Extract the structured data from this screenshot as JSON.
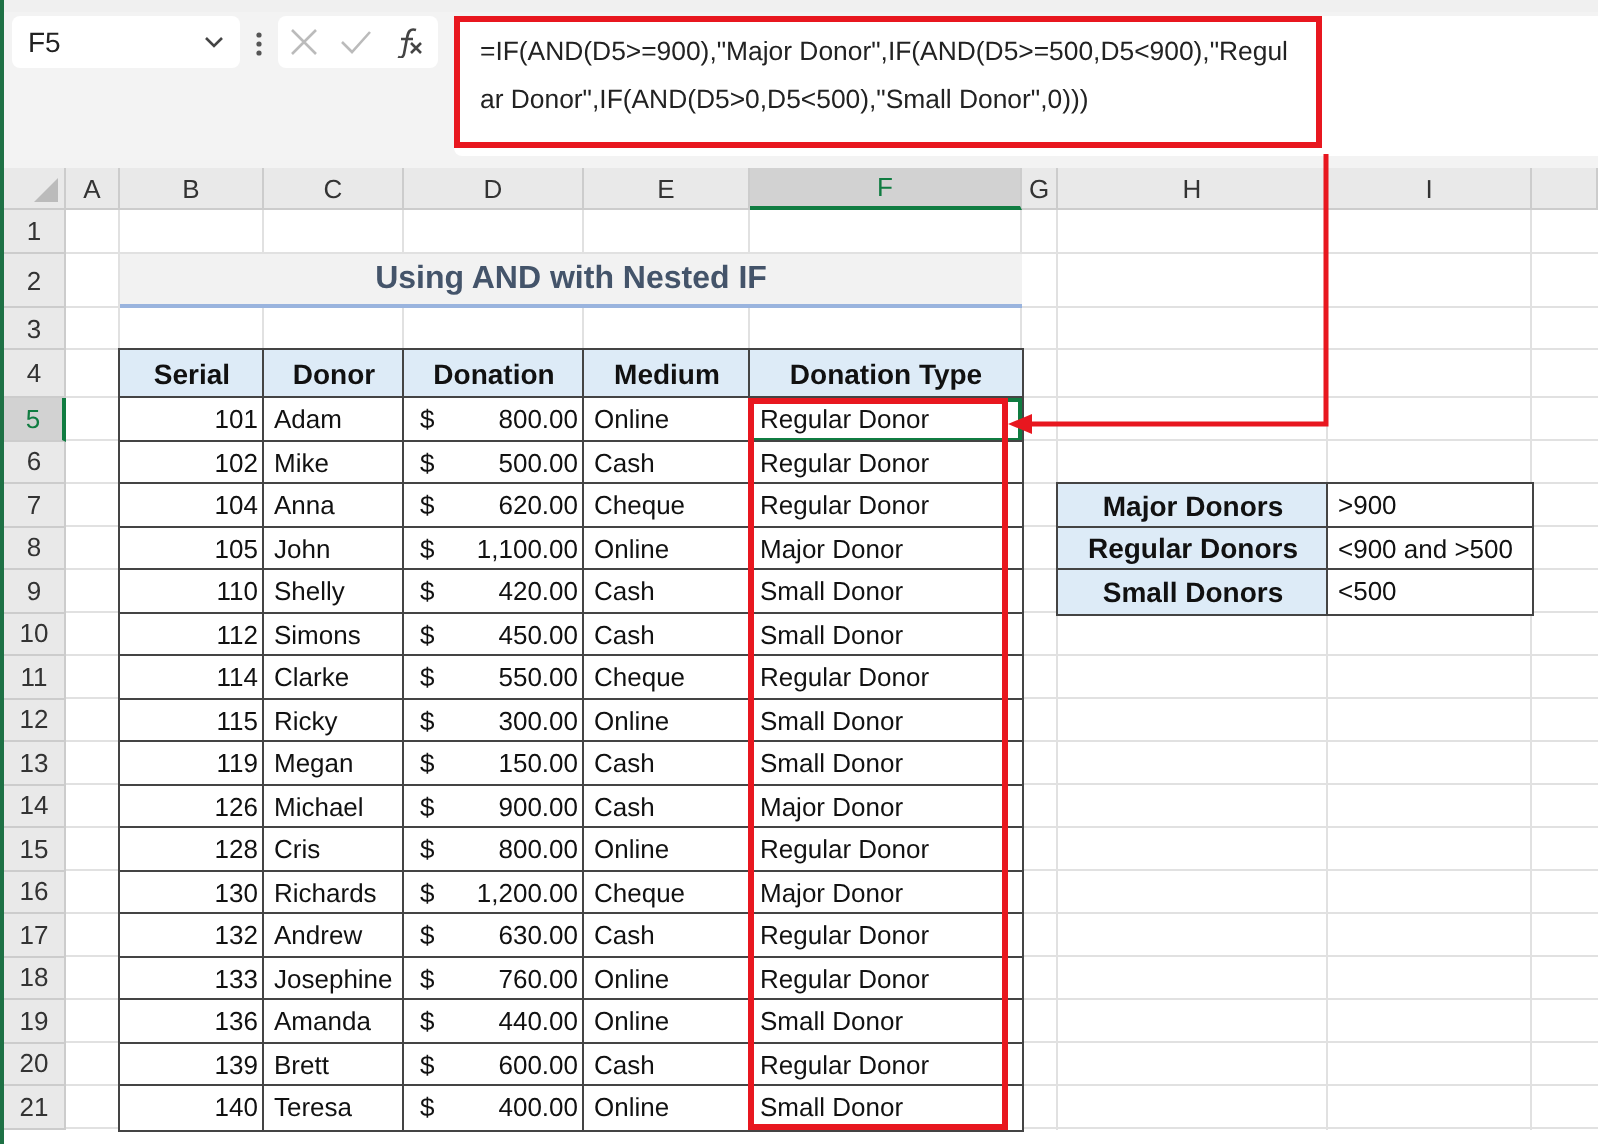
{
  "name_box": "F5",
  "formula": "=IF(AND(D5>=900),\"Major Donor\",IF(AND(D5>=500,D5<900),\"Regular Donor\",IF(AND(D5>0,D5<500),\"Small Donor\",0)))",
  "columns": [
    {
      "label": "A",
      "selected": false
    },
    {
      "label": "B",
      "selected": false
    },
    {
      "label": "C",
      "selected": false
    },
    {
      "label": "D",
      "selected": false
    },
    {
      "label": "E",
      "selected": false
    },
    {
      "label": "F",
      "selected": true
    },
    {
      "label": "G",
      "selected": false
    },
    {
      "label": "H",
      "selected": false
    },
    {
      "label": "I",
      "selected": false
    }
  ],
  "row_numbers": [
    {
      "label": "1",
      "selected": false
    },
    {
      "label": "2",
      "selected": false
    },
    {
      "label": "3",
      "selected": false
    },
    {
      "label": "4",
      "selected": false
    },
    {
      "label": "5",
      "selected": true
    },
    {
      "label": "6",
      "selected": false
    },
    {
      "label": "7",
      "selected": false
    },
    {
      "label": "8",
      "selected": false
    },
    {
      "label": "9",
      "selected": false
    },
    {
      "label": "10",
      "selected": false
    },
    {
      "label": "11",
      "selected": false
    },
    {
      "label": "12",
      "selected": false
    },
    {
      "label": "13",
      "selected": false
    },
    {
      "label": "14",
      "selected": false
    },
    {
      "label": "15",
      "selected": false
    },
    {
      "label": "16",
      "selected": false
    },
    {
      "label": "17",
      "selected": false
    },
    {
      "label": "18",
      "selected": false
    },
    {
      "label": "19",
      "selected": false
    },
    {
      "label": "20",
      "selected": false
    },
    {
      "label": "21",
      "selected": false
    }
  ],
  "title": "Using AND with Nested IF",
  "table": {
    "columns": [
      "Serial",
      "Donor",
      "Donation",
      "Medium",
      "Donation Type"
    ],
    "rows": [
      {
        "serial": "101",
        "donor": "Adam",
        "currency": "$",
        "donation": "800.00",
        "medium": "Online",
        "type": "Regular Donor",
        "selected": true
      },
      {
        "serial": "102",
        "donor": "Mike",
        "currency": "$",
        "donation": "500.00",
        "medium": "Cash",
        "type": "Regular Donor",
        "selected": false
      },
      {
        "serial": "104",
        "donor": "Anna",
        "currency": "$",
        "donation": "620.00",
        "medium": "Cheque",
        "type": "Regular Donor",
        "selected": false
      },
      {
        "serial": "105",
        "donor": "John",
        "currency": "$",
        "donation": "1,100.00",
        "medium": "Online",
        "type": "Major Donor",
        "selected": false
      },
      {
        "serial": "110",
        "donor": "Shelly",
        "currency": "$",
        "donation": "420.00",
        "medium": "Cash",
        "type": "Small Donor",
        "selected": false
      },
      {
        "serial": "112",
        "donor": "Simons",
        "currency": "$",
        "donation": "450.00",
        "medium": "Cash",
        "type": "Small Donor",
        "selected": false
      },
      {
        "serial": "114",
        "donor": "Clarke",
        "currency": "$",
        "donation": "550.00",
        "medium": "Cheque",
        "type": "Regular Donor",
        "selected": false
      },
      {
        "serial": "115",
        "donor": "Ricky",
        "currency": "$",
        "donation": "300.00",
        "medium": "Online",
        "type": "Small Donor",
        "selected": false
      },
      {
        "serial": "119",
        "donor": "Megan",
        "currency": "$",
        "donation": "150.00",
        "medium": "Cash",
        "type": "Small Donor",
        "selected": false
      },
      {
        "serial": "126",
        "donor": "Michael",
        "currency": "$",
        "donation": "900.00",
        "medium": "Cash",
        "type": "Major Donor",
        "selected": false
      },
      {
        "serial": "128",
        "donor": "Cris",
        "currency": "$",
        "donation": "800.00",
        "medium": "Online",
        "type": "Regular Donor",
        "selected": false
      },
      {
        "serial": "130",
        "donor": "Richards",
        "currency": "$",
        "donation": "1,200.00",
        "medium": "Cheque",
        "type": "Major Donor",
        "selected": false
      },
      {
        "serial": "132",
        "donor": "Andrew",
        "currency": "$",
        "donation": "630.00",
        "medium": "Cash",
        "type": "Regular Donor",
        "selected": false
      },
      {
        "serial": "133",
        "donor": "Josephine",
        "currency": "$",
        "donation": "760.00",
        "medium": "Online",
        "type": "Regular Donor",
        "selected": false
      },
      {
        "serial": "136",
        "donor": "Amanda",
        "currency": "$",
        "donation": "440.00",
        "medium": "Online",
        "type": "Small Donor",
        "selected": false
      },
      {
        "serial": "139",
        "donor": "Brett",
        "currency": "$",
        "donation": "600.00",
        "medium": "Cash",
        "type": "Regular Donor",
        "selected": false
      },
      {
        "serial": "140",
        "donor": "Teresa",
        "currency": "$",
        "donation": "400.00",
        "medium": "Online",
        "type": "Small Donor",
        "selected": false
      }
    ]
  },
  "criteria": [
    {
      "label": "Major Donors",
      "rule": ">900"
    },
    {
      "label": "Regular Donors",
      "rule": "<900 and >500"
    },
    {
      "label": "Small Donors",
      "rule": "<500"
    }
  ]
}
